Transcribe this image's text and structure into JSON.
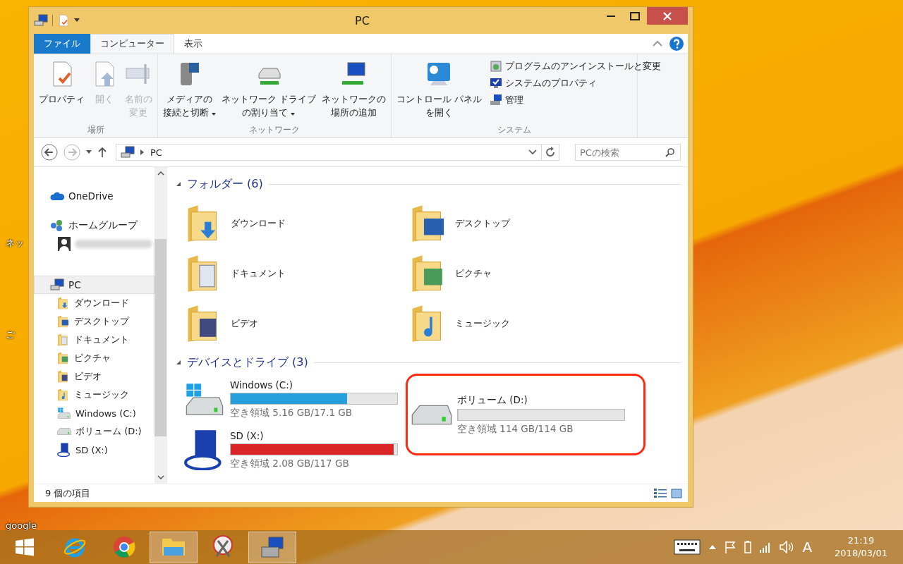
{
  "desktop": {
    "icons": [
      {
        "label": "ネッ"
      },
      {
        "label": "ご"
      },
      {
        "label": "google"
      }
    ]
  },
  "window": {
    "title": "PC"
  },
  "ribbon": {
    "tabs": [
      {
        "label": "ファイル",
        "kind": "file",
        "selected": false
      },
      {
        "label": "コンピューター",
        "kind": "tab",
        "selected": true
      },
      {
        "label": "表示",
        "kind": "tab",
        "selected": false
      }
    ],
    "groups": [
      {
        "label": "場所",
        "buttons": [
          {
            "lines": [
              "プロパティ"
            ],
            "kind": "properties",
            "disabled": false,
            "dropdown": false
          },
          {
            "lines": [
              "開く"
            ],
            "kind": "open",
            "disabled": true,
            "dropdown": false
          },
          {
            "lines": [
              "名前の",
              "変更"
            ],
            "kind": "rename",
            "disabled": true,
            "dropdown": false
          }
        ]
      },
      {
        "label": "ネットワーク",
        "buttons": [
          {
            "lines": [
              "メディアの",
              "接続と切断"
            ],
            "kind": "media",
            "disabled": false,
            "dropdown": true
          },
          {
            "lines": [
              "ネットワーク ドライブ",
              "の割り当て"
            ],
            "kind": "netdrive",
            "disabled": false,
            "dropdown": true
          },
          {
            "lines": [
              "ネットワークの",
              "場所の追加"
            ],
            "kind": "netplace",
            "disabled": false,
            "dropdown": false
          }
        ]
      },
      {
        "label": "システム",
        "buttons": [
          {
            "lines": [
              "コントロール パネル",
              "を開く"
            ],
            "kind": "control",
            "disabled": false,
            "dropdown": false
          }
        ],
        "small_buttons": [
          {
            "label": "プログラムのアンインストールと変更",
            "kind": "uninstall"
          },
          {
            "label": "システムのプロパティ",
            "kind": "sysprops"
          },
          {
            "label": "管理",
            "kind": "manage"
          }
        ]
      }
    ]
  },
  "address": {
    "path": "PC",
    "search_placeholder": "PCの検索"
  },
  "nav": [
    {
      "label": "OneDrive",
      "kind": "cloud",
      "selected": false
    },
    {
      "label": "ホームグループ",
      "kind": "homegroup",
      "selected": false,
      "children": [
        {
          "kind": "user"
        }
      ]
    },
    {
      "label": "PC",
      "kind": "pc",
      "selected": true,
      "children": [
        {
          "kind": "download",
          "label": "ダウンロード"
        },
        {
          "kind": "desktop",
          "label": "デスクトップ"
        },
        {
          "kind": "documents",
          "label": "ドキュメント"
        },
        {
          "kind": "pictures",
          "label": "ピクチャ"
        },
        {
          "kind": "videos",
          "label": "ビデオ"
        },
        {
          "kind": "music",
          "label": "ミュージック"
        },
        {
          "kind": "windrive",
          "label": "Windows (C:)"
        },
        {
          "kind": "drive",
          "label": "ボリューム (D:)"
        },
        {
          "kind": "sd",
          "label": "SD (X:)"
        }
      ]
    }
  ],
  "sections": [
    {
      "title": "フォルダー (6)",
      "kind": "folders",
      "expanded": true,
      "items": [
        {
          "name": "ダウンロード",
          "kind": "download"
        },
        {
          "name": "デスクトップ",
          "kind": "desktop"
        },
        {
          "name": "ドキュメント",
          "kind": "documents"
        },
        {
          "name": "ピクチャ",
          "kind": "pictures"
        },
        {
          "name": "ビデオ",
          "kind": "videos"
        },
        {
          "name": "ミュージック",
          "kind": "music"
        }
      ]
    },
    {
      "title": "デバイスとドライブ (3)",
      "kind": "drives",
      "expanded": true,
      "items": [
        {
          "name": "Windows (C:)",
          "kind": "windrive",
          "level": 0.7,
          "color": "#26a0da",
          "space": "空き領域 5.16 GB/17.1 GB",
          "highlighted": false
        },
        {
          "name": "ボリューム (D:)",
          "kind": "drive",
          "level": 0,
          "space": "空き領域 114 GB/114 GB",
          "highlighted": true
        },
        {
          "name": "SD (X:)",
          "kind": "sd",
          "level": 0.98,
          "color": "#da2626",
          "space": "空き領域 2.08 GB/117 GB",
          "highlighted": false
        }
      ]
    }
  ],
  "status_bar": {
    "count": "9 個の項目"
  },
  "taskbar": {
    "apps": [
      {
        "kind": "ie",
        "running": false
      },
      {
        "kind": "chrome",
        "running": false
      },
      {
        "kind": "explorer",
        "running": true
      },
      {
        "kind": "scissors",
        "running": false
      },
      {
        "kind": "manage",
        "running": true
      }
    ],
    "ime": "A",
    "time": "21:19",
    "date": "2018/03/01"
  }
}
